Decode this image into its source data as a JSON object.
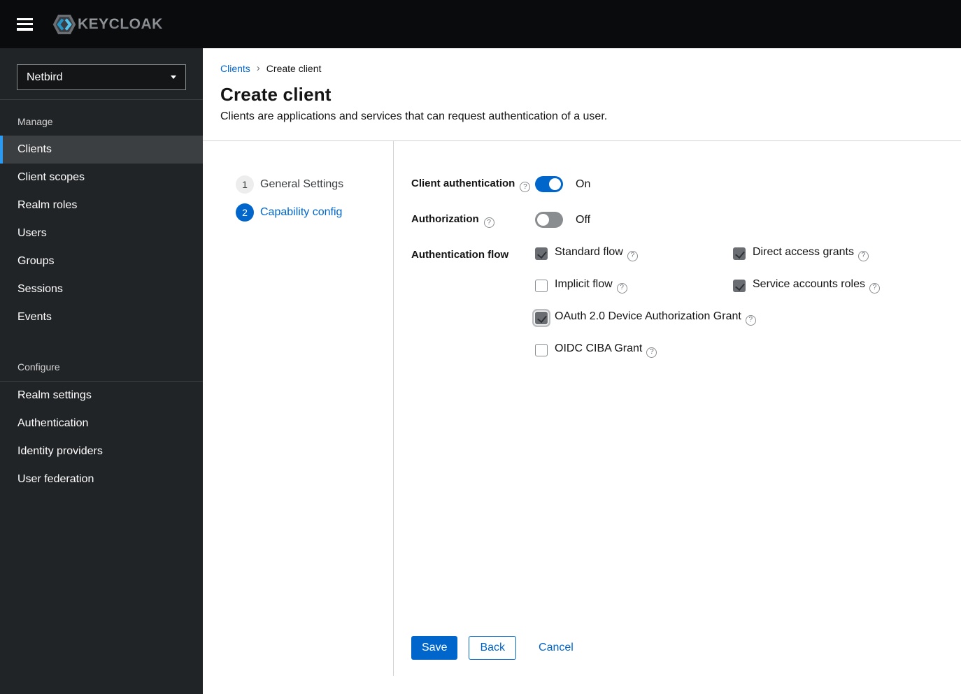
{
  "topbar": {
    "logo_text": "KEYCLOAK"
  },
  "sidebar": {
    "realm": "Netbird",
    "sections": [
      {
        "title": "Manage",
        "items": [
          {
            "label": "Clients",
            "active": true
          },
          {
            "label": "Client scopes",
            "active": false
          },
          {
            "label": "Realm roles",
            "active": false
          },
          {
            "label": "Users",
            "active": false
          },
          {
            "label": "Groups",
            "active": false
          },
          {
            "label": "Sessions",
            "active": false
          },
          {
            "label": "Events",
            "active": false
          }
        ]
      },
      {
        "title": "Configure",
        "items": [
          {
            "label": "Realm settings",
            "active": false
          },
          {
            "label": "Authentication",
            "active": false
          },
          {
            "label": "Identity providers",
            "active": false
          },
          {
            "label": "User federation",
            "active": false
          }
        ]
      }
    ]
  },
  "breadcrumb": {
    "link": "Clients",
    "current": "Create client"
  },
  "page": {
    "title": "Create client",
    "subtitle": "Clients are applications and services that can request authentication of a user."
  },
  "wizard": {
    "steps": [
      {
        "num": "1",
        "label": "General Settings",
        "active": false
      },
      {
        "num": "2",
        "label": "Capability config",
        "active": true
      }
    ]
  },
  "form": {
    "client_auth": {
      "label": "Client authentication",
      "state": "On",
      "enabled": true
    },
    "authorization": {
      "label": "Authorization",
      "state": "Off",
      "enabled": false
    },
    "auth_flow": {
      "label": "Authentication flow",
      "options": [
        {
          "label": "Standard flow",
          "checked": true
        },
        {
          "label": "Direct access grants",
          "checked": true
        },
        {
          "label": "Implicit flow",
          "checked": false
        },
        {
          "label": "Service accounts roles",
          "checked": true
        },
        {
          "label": "OAuth 2.0 Device Authorization Grant",
          "checked": true,
          "focused": true
        },
        {
          "label": "OIDC CIBA Grant",
          "checked": false
        }
      ]
    },
    "buttons": {
      "save": "Save",
      "back": "Back",
      "cancel": "Cancel"
    }
  },
  "colors": {
    "accent": "#0066cc",
    "nav_active_indicator": "#2b9af3",
    "sidebar_bg": "#212427",
    "topbar_bg": "#0a0b0d"
  }
}
